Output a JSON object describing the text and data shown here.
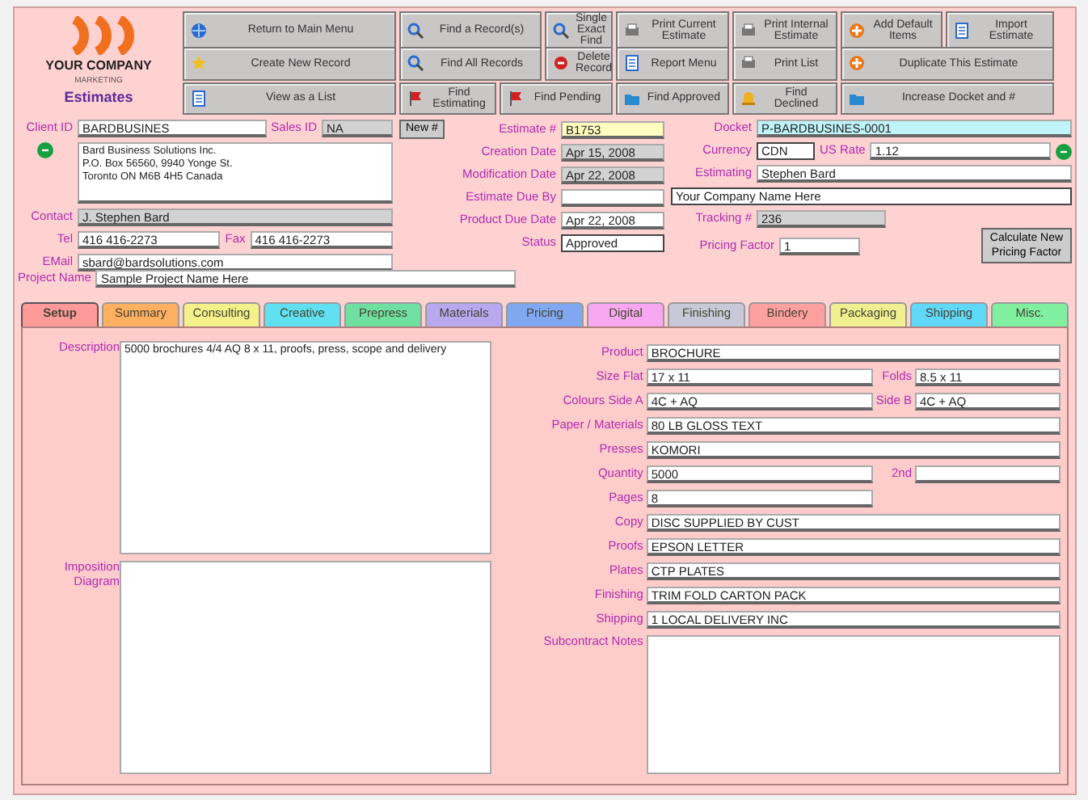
{
  "logo": {
    "company": "YOUR COMPANY",
    "tagline": "MARKETING",
    "module": "Estimates"
  },
  "toolbar": [
    [
      {
        "label": "Return to Main Menu",
        "kind": "globe"
      },
      {
        "label": "Find a Record(s)",
        "kind": "search"
      },
      {
        "label": "Single Exact Find",
        "kind": "search"
      },
      {
        "label": "Print Current Estimate",
        "kind": "print"
      },
      {
        "label": "Print Internal Estimate",
        "kind": "print"
      },
      {
        "label": "Add Default Items",
        "kind": "add"
      },
      {
        "label": "Import Estimate",
        "kind": "doc"
      }
    ],
    [
      {
        "label": "Create New Record",
        "kind": "star"
      },
      {
        "label": "Find All Records",
        "kind": "search"
      },
      {
        "label": "Delete Record",
        "kind": "delete"
      },
      {
        "label": "Report Menu",
        "kind": "doc"
      },
      {
        "label": "Print List",
        "kind": "print"
      },
      {
        "label": "Duplicate This Estimate",
        "kind": "add"
      }
    ],
    [
      {
        "label": "View as a List",
        "kind": "doc"
      },
      {
        "label": "Find Estimating",
        "kind": "flag"
      },
      {
        "label": "Find Pending",
        "kind": "flag"
      },
      {
        "label": "Find Approved",
        "kind": "folder"
      },
      {
        "label": "Find Declined",
        "kind": "bell"
      },
      {
        "label": "Increase Docket and #",
        "kind": "folder"
      }
    ]
  ],
  "client": {
    "client_id": {
      "label": "Client ID",
      "value": "BARDBUSINES"
    },
    "sales_id": {
      "label": "Sales ID",
      "value": "NA"
    },
    "address": [
      "Bard Business Solutions Inc.",
      "P.O. Box 56560, 9940 Yonge St.",
      "Toronto ON M6B 4H5 Canada"
    ],
    "contact": {
      "label": "Contact",
      "value": "J. Stephen Bard"
    },
    "tel": {
      "label": "Tel",
      "value": "416 416-2273"
    },
    "fax": {
      "label": "Fax",
      "value": "416 416-2273"
    },
    "email": {
      "label": "EMail",
      "value": "sbard@bardsolutions.com"
    }
  },
  "new_button": "New #",
  "dates": [
    {
      "label": "Estimate #",
      "value": "B1753",
      "kind": "key"
    },
    {
      "label": "Creation Date",
      "value": "Apr 15, 2008",
      "kind": "locked"
    },
    {
      "label": "Modification Date",
      "value": "Apr 22, 2008",
      "kind": "locked"
    },
    {
      "label": "Estimate Due By",
      "kind": "text"
    },
    {
      "label": "Product Due Date",
      "value": "Apr 22, 2008",
      "kind": "text"
    },
    {
      "label": "Status",
      "value": "Approved",
      "kind": "dropdown"
    }
  ],
  "job": {
    "docket": {
      "label": "Docket",
      "value": "P-BARDBUSINES-0001"
    },
    "currency": {
      "label": "Currency",
      "value": "CDN"
    },
    "us_rate": {
      "label": "US Rate",
      "value": "1.12"
    },
    "estimating": {
      "label": "Estimating",
      "value": "Stephen Bard"
    },
    "company": "Your Company Name Here",
    "tracking": {
      "label": "Tracking #",
      "value": "236"
    },
    "pricing_factor": {
      "label": "Pricing Factor",
      "value": "1"
    },
    "calc_button": "Calculate New Pricing Factor"
  },
  "project": {
    "label": "Project Name",
    "value": "Sample Project Name Here"
  },
  "tabs": [
    {
      "label": "Setup",
      "color": "#ff9a9a",
      "selected": true
    },
    {
      "label": "Summary",
      "color": "#ffb060",
      "selected": false
    },
    {
      "label": "Consulting",
      "color": "#f4f08a",
      "selected": false
    },
    {
      "label": "Creative",
      "color": "#60e0f0",
      "selected": false
    },
    {
      "label": "Prepress",
      "color": "#70e0a0",
      "selected": false
    },
    {
      "label": "Materials",
      "color": "#b8a8f0",
      "selected": false
    },
    {
      "label": "Pricing",
      "color": "#80a8f0",
      "selected": false
    },
    {
      "label": "Digital",
      "color": "#f8a8f0",
      "selected": false
    },
    {
      "label": "Finishing",
      "color": "#c8c8d8",
      "selected": false
    },
    {
      "label": "Bindery",
      "color": "#ffa0a0",
      "selected": false
    },
    {
      "label": "Packaging",
      "color": "#f0f090",
      "selected": false
    },
    {
      "label": "Shipping",
      "color": "#60d8f8",
      "selected": false
    },
    {
      "label": "Misc.",
      "color": "#80f0a0",
      "selected": false
    }
  ],
  "setup": {
    "description": {
      "label": "Description",
      "value": "5000 brochures 4/4 AQ 8 x 11, proofs, press, scope and delivery"
    },
    "imposition": {
      "label": "Imposition Diagram"
    },
    "specs": [
      {
        "label": "Product",
        "value": "BROCHURE"
      },
      {
        "label": "Size Flat",
        "value": "17 x 11",
        "second": {
          "label": "Folds",
          "value": "8.5 x 11"
        }
      },
      {
        "label": "Colours Side A",
        "value": "4C + AQ",
        "second": {
          "label": "Side B",
          "value": "4C + AQ"
        }
      },
      {
        "label": "Paper / Materials",
        "value": "80 LB GLOSS TEXT"
      },
      {
        "label": "Presses",
        "value": "KOMORI"
      },
      {
        "label": "Quantity",
        "value": "5000",
        "second": {
          "label": "2nd"
        }
      },
      {
        "label": "Pages",
        "value": "8",
        "half": true
      },
      {
        "label": "Copy",
        "value": "DISC SUPPLIED BY CUST"
      },
      {
        "label": "Proofs",
        "value": "EPSON LETTER"
      },
      {
        "label": "Plates",
        "value": "CTP PLATES"
      },
      {
        "label": "Finishing",
        "value": "TRIM FOLD CARTON PACK"
      },
      {
        "label": "Shipping",
        "value": "1 LOCAL DELIVERY INC"
      }
    ],
    "notes": {
      "label": "Subcontract Notes"
    }
  }
}
